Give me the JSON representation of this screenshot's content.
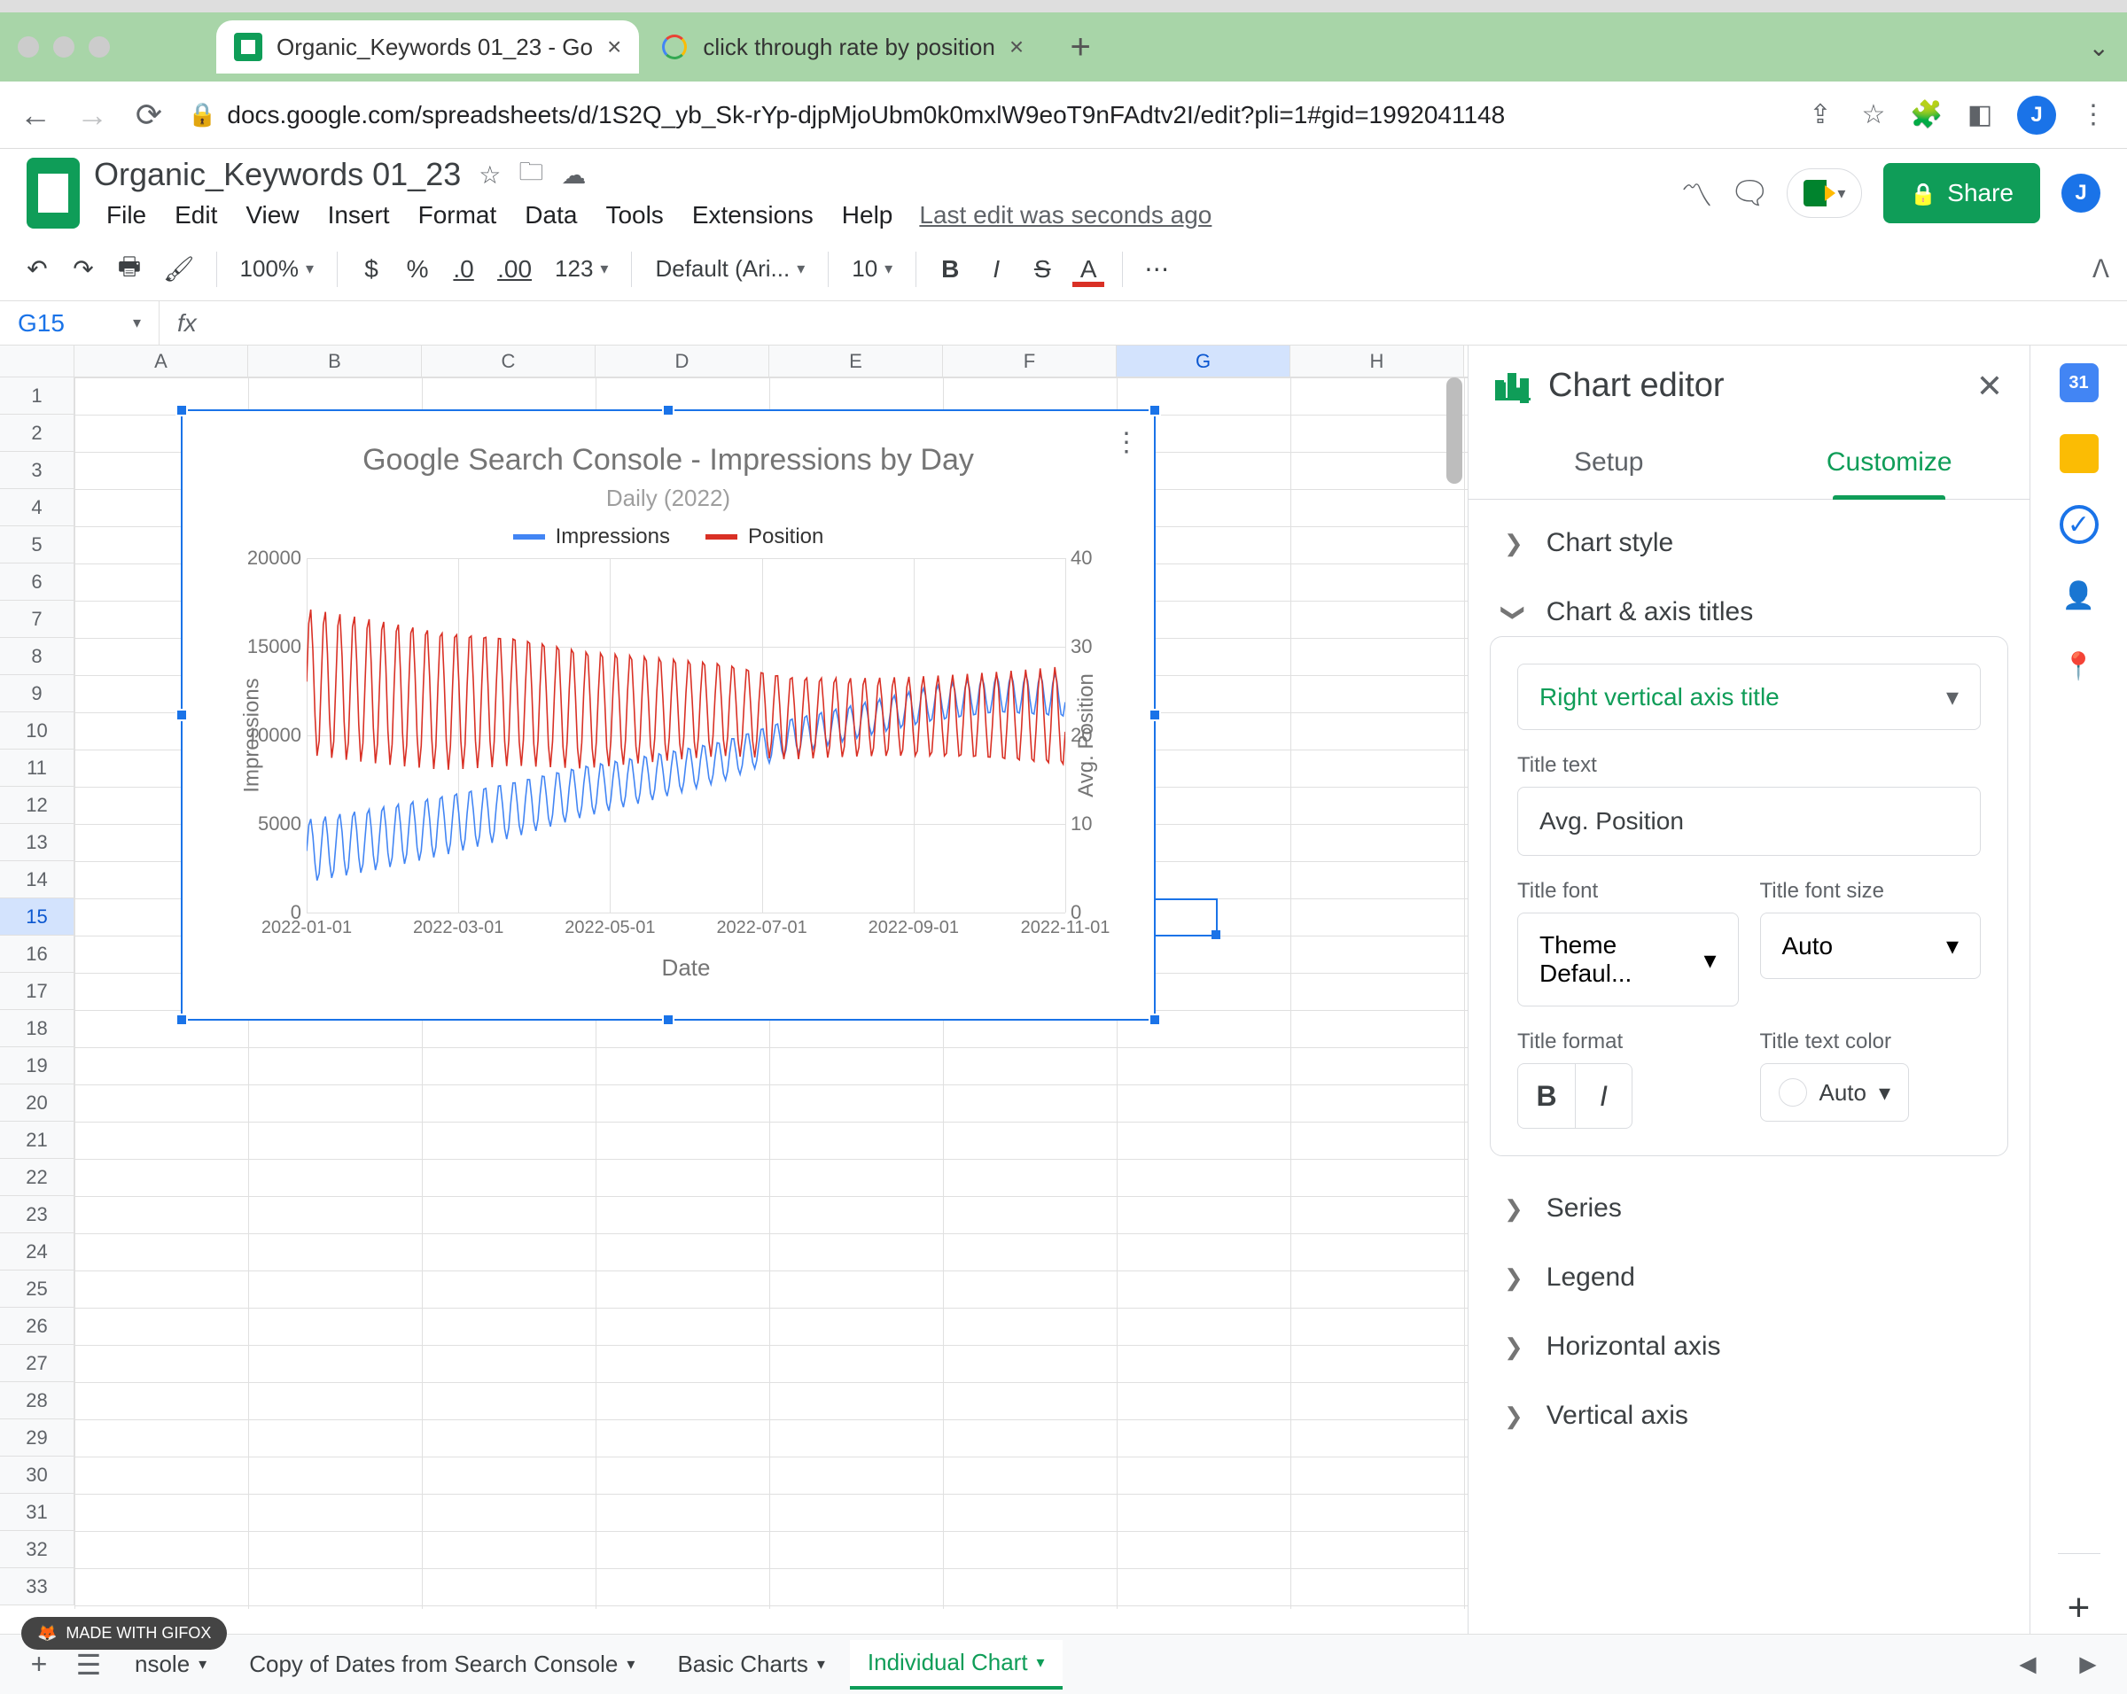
{
  "browser": {
    "tabs": [
      {
        "title": "Organic_Keywords 01_23 - Go"
      },
      {
        "title": "click through rate by position"
      }
    ],
    "url": "docs.google.com/spreadsheets/d/1S2Q_yb_Sk-rYp-djpMjoUbm0k0mxlW9eoT9nFAdtv2I/edit?pli=1#gid=1992041148"
  },
  "doc": {
    "title": "Organic_Keywords 01_23",
    "last_edit": "Last edit was seconds ago",
    "menus": [
      "File",
      "Edit",
      "View",
      "Insert",
      "Format",
      "Data",
      "Tools",
      "Extensions",
      "Help"
    ],
    "share_label": "Share",
    "avatar_initial": "J"
  },
  "toolbar": {
    "zoom": "100%",
    "font": "Default (Ari...",
    "font_size": "10",
    "items": {
      "currency": "$",
      "percent": "%",
      "dec_less": ".0",
      "dec_more": ".00",
      "numfmt": "123"
    }
  },
  "cell": {
    "name": "G15"
  },
  "columns": [
    "A",
    "B",
    "C",
    "D",
    "E",
    "F",
    "G",
    "H"
  ],
  "row_count": 33,
  "chart_data": {
    "type": "line",
    "title": "Google Search Console - Impressions by Day",
    "subtitle": "Daily (2022)",
    "xlabel": "Date",
    "ylabel_left": "Impressions",
    "ylabel_right": "Avg. Position",
    "ylim_left": [
      0,
      20000
    ],
    "ylim_right": [
      0,
      40
    ],
    "yticks_left": [
      0,
      5000,
      10000,
      15000,
      20000
    ],
    "yticks_right": [
      0,
      10,
      20,
      30,
      40
    ],
    "xticks": [
      "2022-01-01",
      "2022-03-01",
      "2022-05-01",
      "2022-07-01",
      "2022-09-01",
      "2022-11-01"
    ],
    "x_range_months": 12,
    "series": [
      {
        "name": "Impressions",
        "color": "#4285f4",
        "axis": "left",
        "trend_values_by_month": [
          3400,
          4100,
          4900,
          5800,
          6800,
          7600,
          8500,
          9900,
          10800,
          11700,
          12300,
          12200
        ],
        "variation": "high-frequency daily oscillation roughly ±1500 around trend"
      },
      {
        "name": "Position",
        "color": "#d93025",
        "axis": "right",
        "trend_values_by_month": [
          26,
          25,
          24,
          24,
          23,
          23,
          23,
          22,
          22,
          22,
          22,
          22
        ],
        "variation": "daily oscillation roughly ±7 around trend"
      }
    ]
  },
  "editor": {
    "title": "Chart editor",
    "tabs": {
      "setup": "Setup",
      "customize": "Customize"
    },
    "sections": {
      "chart_style": "Chart style",
      "chart_axis_titles": "Chart & axis titles",
      "series": "Series",
      "legend": "Legend",
      "horizontal_axis": "Horizontal axis",
      "vertical_axis": "Vertical axis"
    },
    "axis_titles": {
      "which_title": "Right vertical axis title",
      "title_text_label": "Title text",
      "title_text_value": "Avg. Position",
      "title_font_label": "Title font",
      "title_font_value": "Theme Defaul...",
      "title_size_label": "Title font size",
      "title_size_value": "Auto",
      "title_format_label": "Title format",
      "title_color_label": "Title text color",
      "title_color_value": "Auto"
    }
  },
  "sheets": {
    "tabs": [
      {
        "label": "nsole",
        "partial": true
      },
      {
        "label": "Copy of Dates from Search Console"
      },
      {
        "label": "Basic Charts"
      },
      {
        "label": "Individual Chart",
        "active": true
      }
    ]
  },
  "badge": "MADE WITH GIFOX"
}
